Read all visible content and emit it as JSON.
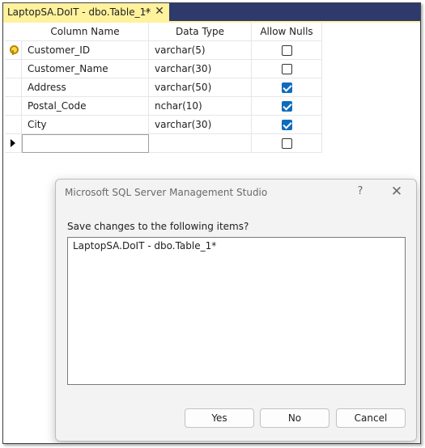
{
  "tab": {
    "title": "LaptopSA.DoIT - dbo.Table_1*",
    "pin_glyph": "⊣",
    "close_glyph": "✕"
  },
  "grid": {
    "headers": [
      "Column Name",
      "Data Type",
      "Allow Nulls"
    ],
    "rows": [
      {
        "name": "Customer_ID",
        "type": "varchar(5)",
        "allow_nulls": false,
        "primary_key": true
      },
      {
        "name": "Customer_Name",
        "type": "varchar(30)",
        "allow_nulls": false,
        "primary_key": false
      },
      {
        "name": "Address",
        "type": "varchar(50)",
        "allow_nulls": true,
        "primary_key": false
      },
      {
        "name": "Postal_Code",
        "type": "nchar(10)",
        "allow_nulls": true,
        "primary_key": false
      },
      {
        "name": "City",
        "type": "varchar(30)",
        "allow_nulls": true,
        "primary_key": false
      }
    ],
    "new_row": {
      "name": "",
      "type": "",
      "allow_nulls": false
    }
  },
  "dialog": {
    "title": "Microsoft SQL Server Management Studio",
    "help_glyph": "?",
    "close_glyph": "✕",
    "prompt": "Save changes to the following items?",
    "items": [
      "LaptopSA.DoIT - dbo.Table_1*"
    ],
    "buttons": {
      "yes": "Yes",
      "no": "No",
      "cancel": "Cancel"
    }
  },
  "colors": {
    "tab_active": "#fff29d",
    "tab_strip": "#2d3a6b",
    "checkbox_checked": "#0f6cbd"
  }
}
